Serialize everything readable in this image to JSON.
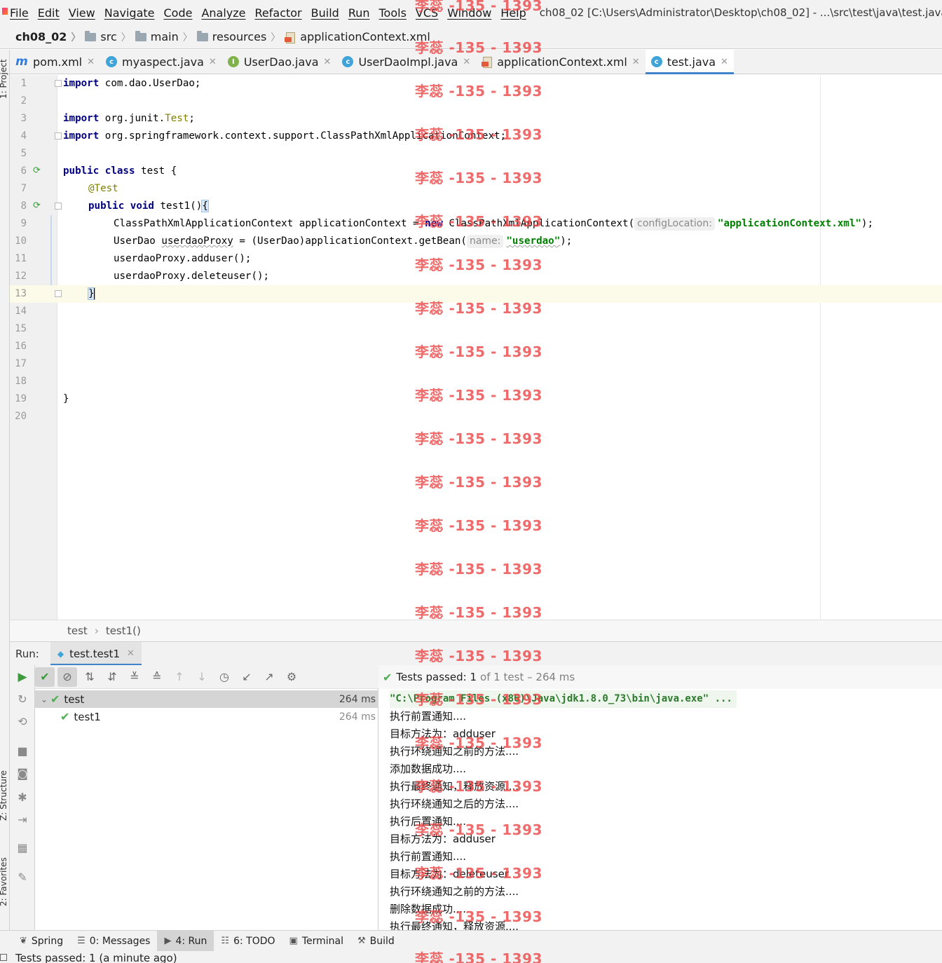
{
  "menu": {
    "items": [
      "File",
      "Edit",
      "View",
      "Navigate",
      "Code",
      "Analyze",
      "Refactor",
      "Build",
      "Run",
      "Tools",
      "VCS",
      "Window",
      "Help"
    ],
    "window_title": "ch08_02 [C:\\Users\\Administrator\\Desktop\\ch08_02] - ...\\src\\test\\java\\test.java -"
  },
  "navbar": {
    "crumbs": [
      "ch08_02",
      "src",
      "main",
      "resources",
      "applicationContext.xml"
    ]
  },
  "tabs": [
    {
      "label": "pom.xml",
      "icon": "maven-icon"
    },
    {
      "label": "myaspect.java",
      "icon": "class-icon"
    },
    {
      "label": "UserDao.java",
      "icon": "interface-icon"
    },
    {
      "label": "UserDaoImpl.java",
      "icon": "class-icon"
    },
    {
      "label": "applicationContext.xml",
      "icon": "xml-icon"
    },
    {
      "label": "test.java",
      "icon": "class-icon",
      "active": true
    }
  ],
  "left_strip": {
    "project": "1: Project",
    "structure": "Z: Structure",
    "favorites": "2: Favorites"
  },
  "editor": {
    "line_numbers": [
      "1",
      "2",
      "3",
      "4",
      "5",
      "6",
      "7",
      "8",
      "9",
      "10",
      "11",
      "12",
      "13",
      "14",
      "15",
      "16",
      "17",
      "18",
      "19",
      "20"
    ],
    "code": {
      "l1_kw": "import",
      "l1_rest": " com.dao.UserDao;",
      "l3_kw": "import",
      "l3_rest": " org.junit.",
      "l3_ann": "Test",
      "l3_end": ";",
      "l4_kw": "import",
      "l4_rest": " org.springframework.context.support.ClassPathXmlApplicationContext;",
      "l6_kw": "public class",
      "l6_rest": " test {",
      "l7_ann": "@Test",
      "l8_kw": "public void",
      "l8_rest": " test1()",
      "l8_brace": "{",
      "l9_pre": "ClassPathXmlApplicationContext applicationContext = ",
      "l9_kw": "new",
      "l9_mid": " ClassPathXmlApplicationContext(",
      "l9_hint": "configLocation:",
      "l9_str": "\"applicationContext.xml\"",
      "l9_end": ");",
      "l10_pre": "UserDao ",
      "l10_var": "userdaoProxy",
      "l10_mid": " = (UserDao)applicationContext.getBean(",
      "l10_hint": "name:",
      "l10_str": "\"userdao\"",
      "l10_end": ");",
      "l11": "userdaoProxy.adduser();",
      "l12": "userdaoProxy.deleteuser();",
      "l13": "}",
      "l19": "}"
    },
    "breadcrumbs": [
      "test",
      "test1()"
    ]
  },
  "run": {
    "label": "Run:",
    "tab_label": "test.test1",
    "status_prefix": "Tests passed:",
    "status_count": "1",
    "status_rest": "of 1 test – 264 ms",
    "tree": [
      {
        "label": "test",
        "time": "264 ms"
      },
      {
        "label": "test1",
        "time": "264 ms"
      }
    ],
    "console": [
      "\"C:\\Program Files (x86)\\Java\\jdk1.8.0_73\\bin\\java.exe\" ...",
      "执行前置通知....",
      "目标方法为：adduser",
      "执行环绕通知之前的方法....",
      "添加数据成功....",
      "执行最终通知，释放资源....",
      "执行环绕通知之后的方法....",
      "执行后置通知....",
      "目标方法为：adduser",
      "执行前置通知....",
      "目标方法为：deleteuser",
      "执行环绕通知之前的方法....",
      "删除数据成功....",
      "执行最终通知，释放资源...."
    ]
  },
  "tool_tabs": [
    {
      "label": "Spring",
      "icon": "spring-icon"
    },
    {
      "label": "0: Messages",
      "icon": "messages-icon"
    },
    {
      "label": "4: Run",
      "icon": "run-icon",
      "active": true
    },
    {
      "label": "6: TODO",
      "icon": "todo-icon"
    },
    {
      "label": "Terminal",
      "icon": "terminal-icon"
    },
    {
      "label": "Build",
      "icon": "build-icon"
    }
  ],
  "statusbar": {
    "text": "Tests passed: 1 (a minute ago)"
  },
  "watermark": {
    "text": "李蕊 -135 - 1393"
  },
  "colors": {
    "accent": "#4083c9",
    "success": "#4caf50",
    "watermark": "#eb4646"
  }
}
